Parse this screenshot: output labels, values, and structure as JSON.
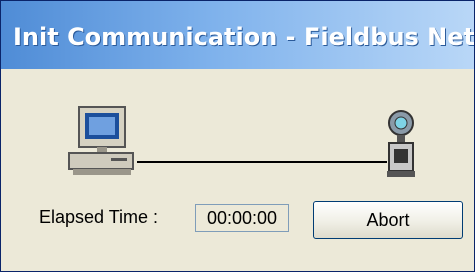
{
  "window": {
    "title": "Init Communication - Fieldbus Net..."
  },
  "diagram": {
    "left_icon": "computer-icon",
    "right_icon": "fieldbus-device-icon"
  },
  "status": {
    "elapsed_label": "Elapsed Time :",
    "elapsed_value": "00:00:00"
  },
  "buttons": {
    "abort_label": "Abort"
  },
  "colors": {
    "title_bar": "#7fb2ec",
    "dialog_face": "#ece9d8",
    "button_border": "#003c74"
  }
}
